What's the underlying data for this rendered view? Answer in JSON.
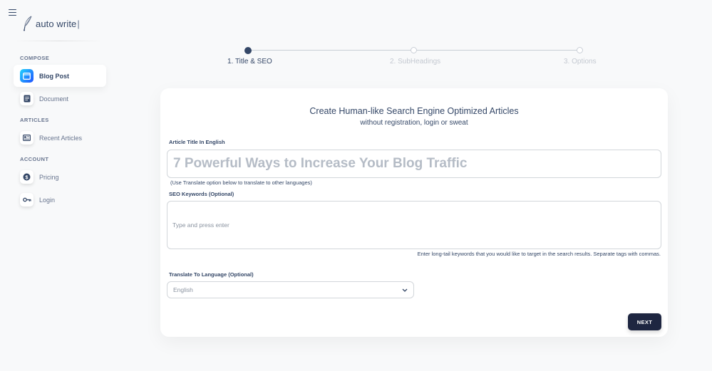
{
  "brand": {
    "name": "auto write",
    "caret": "|",
    "logo_icon": "quill-pen-icon"
  },
  "sidebar": {
    "sections": [
      {
        "title": "COMPOSE",
        "items": [
          {
            "label": "Blog Post",
            "icon": "browser-window-icon",
            "active": true
          },
          {
            "label": "Document",
            "icon": "document-icon",
            "active": false
          }
        ]
      },
      {
        "title": "ARTICLES",
        "items": [
          {
            "label": "Recent Articles",
            "icon": "article-list-icon",
            "active": false
          }
        ]
      },
      {
        "title": "ACCOUNT",
        "items": [
          {
            "label": "Pricing",
            "icon": "dollar-coin-icon",
            "active": false
          },
          {
            "label": "Login",
            "icon": "key-icon",
            "active": false
          }
        ]
      }
    ]
  },
  "stepper": {
    "current_step": 1,
    "steps": [
      {
        "label": "1. Title & SEO"
      },
      {
        "label": "2. SubHeadings"
      },
      {
        "label": "3. Options"
      }
    ]
  },
  "form": {
    "title": "Create Human-like Search Engine Optimized Articles",
    "subtitle": "without registration, login or sweat",
    "article_title_label": "Article Title In English",
    "article_title_value": "",
    "article_title_placeholder": "7 Powerful Ways to Increase Your Blog Traffic",
    "translate_hint": "(Use Translate option below to translate to other languages)",
    "keywords_label": "SEO Keywords (Optional)",
    "keywords_value": "",
    "keywords_placeholder": "Type and press enter",
    "keywords_hint": "Enter long-tail keywords that you would like to target in the search results. Separate tags with commas.",
    "language_label": "Translate To Language (Optional)",
    "language_selected": "English",
    "next_label": "NEXT"
  },
  "colors": {
    "accent_gradient_start": "#2152ff",
    "accent_gradient_end": "#21d4fd",
    "primary_text": "#344767",
    "button_dark": "#1e2641"
  }
}
